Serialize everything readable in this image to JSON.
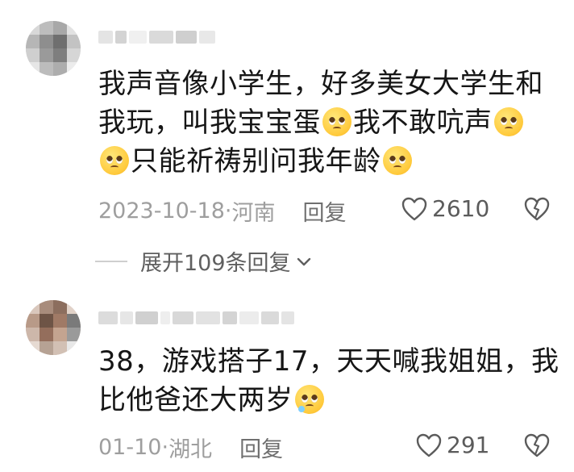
{
  "comments": [
    {
      "lines": [
        [
          "我声音像小学生，好多美女大学生和"
        ],
        [
          "我玩，叫我宝宝蛋",
          "pleading-face",
          "我不敢吭声",
          "pleading-face"
        ],
        [
          "pleading-face",
          "只能祈祷别问我年龄",
          "pleading-face"
        ]
      ],
      "date": "2023-10-18",
      "location": "河南",
      "reply_label": "回复",
      "likes": "2610",
      "expand_label": "展开109条回复"
    },
    {
      "lines": [
        [
          "38，游戏搭子17，天天喊我姐姐，我"
        ],
        [
          "比他爸还大两岁",
          "crying-pleading-face"
        ]
      ],
      "date": "01-10",
      "location": "湖北",
      "reply_label": "回复",
      "likes": "291"
    }
  ],
  "separator": " · ",
  "colors": {
    "meta": "#9e9e9e",
    "text": "#161616",
    "icon": "#5b5b5b"
  }
}
